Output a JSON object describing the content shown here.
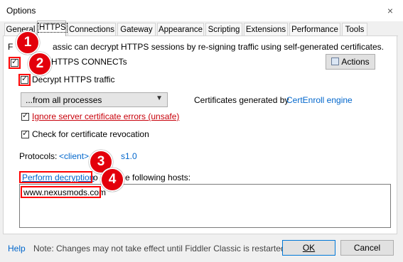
{
  "window": {
    "title": "Options",
    "close_glyph": "×"
  },
  "tabs": [
    {
      "label": "General"
    },
    {
      "label": "HTTPS"
    },
    {
      "label": "Connections"
    },
    {
      "label": "Gateway"
    },
    {
      "label": "Appearance"
    },
    {
      "label": "Scripting"
    },
    {
      "label": "Extensions"
    },
    {
      "label": "Performance"
    },
    {
      "label": "Tools"
    }
  ],
  "https": {
    "intro_prefix": "F",
    "intro_suffix": "assic can decrypt HTTPS sessions by re-signing traffic using self-generated certificates.",
    "capture_label": "HTTPS CONNECTs",
    "capture_checked": true,
    "decrypt_label": "Decrypt HTTPS traffic",
    "decrypt_checked": true,
    "actions_label": "Actions",
    "process_select": "...from all processes",
    "certs_text": "Certificates generated by",
    "certs_link": "CertEnroll engine",
    "ignore_errors_label": "Ignore server certificate errors (unsafe)",
    "ignore_errors_checked": true,
    "revocation_label": "Check for certificate revocation",
    "revocation_checked": true,
    "protocols_label": "Protocols:",
    "protocols_prefix": "<client>",
    "protocols_suffix": "s1.0",
    "perform_decryption_link": "Perform decryption",
    "hosts_label_tail": "e following hosts:",
    "hosts_prefix": "o",
    "hosts_value": "www.nexusmods.com"
  },
  "annotations": [
    "1",
    "2",
    "3",
    "4"
  ],
  "footer": {
    "help": "Help",
    "note": "Note: Changes may not take effect until Fiddler Classic is restarted.",
    "ok": "OK",
    "cancel": "Cancel"
  },
  "colors": {
    "annotation": "#e3000b",
    "link": "#0066cc",
    "warning_link": "#c8000a"
  }
}
